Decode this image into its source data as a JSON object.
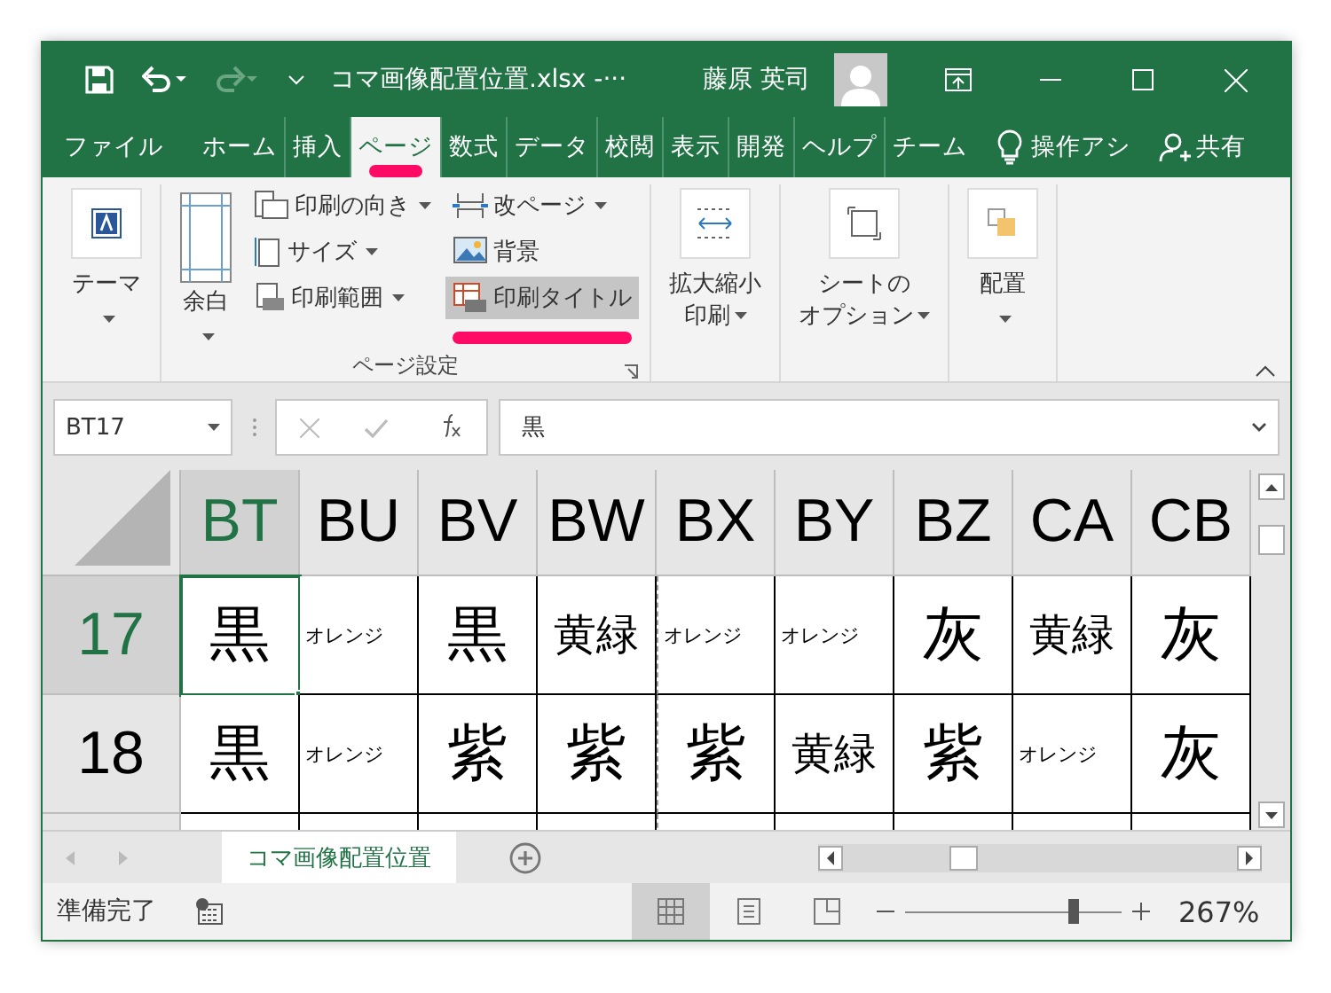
{
  "title_bar": {
    "file_title": "コマ画像配置位置.xlsx -···",
    "user": "藤原 英司",
    "redo_disabled": true
  },
  "tabs": [
    {
      "label": "ファイル",
      "selected": false,
      "highlighted": false
    },
    {
      "label": "ホーム",
      "selected": false,
      "highlighted": false
    },
    {
      "label": "挿入",
      "selected": false,
      "highlighted": false
    },
    {
      "label": "ページ",
      "selected": true,
      "highlighted": true
    },
    {
      "label": "数式",
      "selected": false,
      "highlighted": false
    },
    {
      "label": "データ",
      "selected": false,
      "highlighted": false
    },
    {
      "label": "校閲",
      "selected": false,
      "highlighted": false
    },
    {
      "label": "表示",
      "selected": false,
      "highlighted": false
    },
    {
      "label": "開発",
      "selected": false,
      "highlighted": false
    },
    {
      "label": "ヘルプ",
      "selected": false,
      "highlighted": false
    },
    {
      "label": "チーム",
      "selected": false,
      "highlighted": false
    }
  ],
  "tell_me": "操作アシ",
  "share": "共有",
  "ribbon_groups": [
    {
      "items": [
        {
          "kind": "large",
          "lines": [
            "テーマ"
          ],
          "dropdown": true,
          "hovered": false,
          "highlighted": false
        }
      ]
    },
    {
      "label": "ページ設定",
      "launcher": true,
      "items": [
        {
          "kind": "large",
          "lines": [
            "余白"
          ],
          "dropdown": true,
          "hovered": false,
          "highlighted": false
        },
        {
          "kind": "small",
          "lines": [
            "印刷の向き"
          ],
          "dropdown": true,
          "hovered": false,
          "highlighted": false
        },
        {
          "kind": "small",
          "lines": [
            "サイズ"
          ],
          "dropdown": true,
          "hovered": false,
          "highlighted": false
        },
        {
          "kind": "small",
          "lines": [
            "印刷範囲"
          ],
          "dropdown": true,
          "hovered": false,
          "highlighted": false
        },
        {
          "kind": "small",
          "lines": [
            "改ページ"
          ],
          "dropdown": true,
          "hovered": false,
          "highlighted": false
        },
        {
          "kind": "small",
          "lines": [
            "背景"
          ],
          "dropdown": false,
          "hovered": false,
          "highlighted": false
        },
        {
          "kind": "small",
          "lines": [
            "印刷タイトル"
          ],
          "dropdown": false,
          "hovered": true,
          "highlighted": true
        }
      ]
    },
    {
      "items": [
        {
          "kind": "large",
          "lines": [
            "拡大縮小",
            "印刷"
          ],
          "dropdown": true,
          "hovered": false,
          "highlighted": false
        }
      ]
    },
    {
      "items": [
        {
          "kind": "large",
          "lines": [
            "シートの",
            "オプション"
          ],
          "dropdown": true,
          "hovered": false,
          "highlighted": false
        }
      ]
    },
    {
      "items": [
        {
          "kind": "large",
          "lines": [
            "配置"
          ],
          "dropdown": true,
          "hovered": false,
          "highlighted": false
        }
      ]
    }
  ],
  "formula_bar": {
    "name_box": "BT17",
    "formula": "黒"
  },
  "grid": {
    "columns": [
      {
        "label": "BT",
        "selected": true,
        "page_break_before": false
      },
      {
        "label": "BU",
        "selected": false,
        "page_break_before": false
      },
      {
        "label": "BV",
        "selected": false,
        "page_break_before": false
      },
      {
        "label": "BW",
        "selected": false,
        "page_break_before": false
      },
      {
        "label": "BX",
        "selected": false,
        "page_break_before": true
      },
      {
        "label": "BY",
        "selected": false,
        "page_break_before": false
      },
      {
        "label": "BZ",
        "selected": false,
        "page_break_before": false
      },
      {
        "label": "CA",
        "selected": false,
        "page_break_before": false
      },
      {
        "label": "CB",
        "selected": false,
        "page_break_before": false
      }
    ],
    "rows": [
      {
        "label": "17",
        "selected": true,
        "cells": [
          {
            "text": "黒",
            "kind": "large",
            "active": true
          },
          {
            "text": "オレンジ",
            "kind": "small",
            "active": false
          },
          {
            "text": "黒",
            "kind": "large",
            "active": false
          },
          {
            "text": "黄緑",
            "kind": "medium",
            "active": false
          },
          {
            "text": "オレンジ",
            "kind": "small",
            "active": false
          },
          {
            "text": "オレンジ",
            "kind": "small",
            "active": false
          },
          {
            "text": "灰",
            "kind": "large",
            "active": false
          },
          {
            "text": "黄緑",
            "kind": "medium",
            "active": false
          },
          {
            "text": "灰",
            "kind": "large",
            "active": false
          }
        ]
      },
      {
        "label": "18",
        "selected": false,
        "cells": [
          {
            "text": "黒",
            "kind": "large",
            "active": false
          },
          {
            "text": "オレンジ",
            "kind": "small",
            "active": false
          },
          {
            "text": "紫",
            "kind": "large",
            "active": false
          },
          {
            "text": "紫",
            "kind": "large",
            "active": false
          },
          {
            "text": "紫",
            "kind": "large",
            "active": false
          },
          {
            "text": "黄緑",
            "kind": "medium",
            "active": false
          },
          {
            "text": "紫",
            "kind": "large",
            "active": false
          },
          {
            "text": "オレンジ",
            "kind": "small",
            "active": false
          },
          {
            "text": "灰",
            "kind": "large",
            "active": false
          }
        ]
      }
    ]
  },
  "sheet_tabs": [
    {
      "label": "コマ画像配置位置",
      "selected": true
    }
  ],
  "status_bar": {
    "status": "準備完了",
    "views": [
      {
        "selected": true
      },
      {
        "selected": false
      },
      {
        "selected": false
      }
    ],
    "zoom": {
      "level": 0.78,
      "reading": "267%"
    }
  }
}
